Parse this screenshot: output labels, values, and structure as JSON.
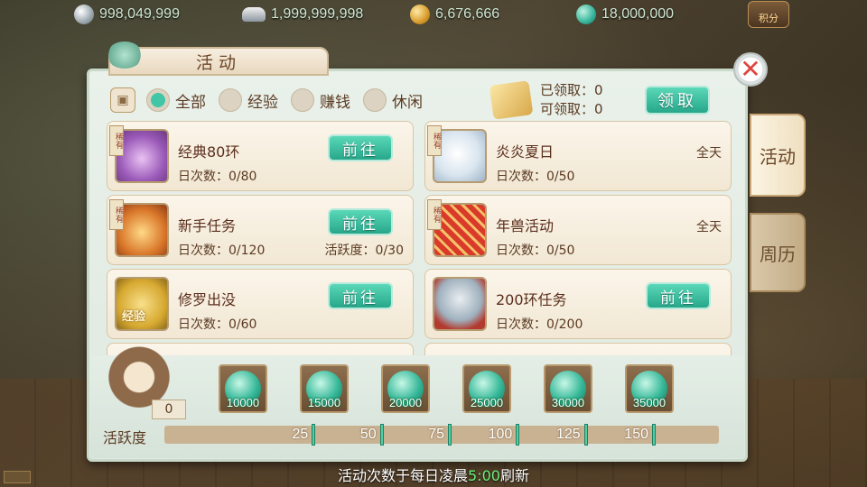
{
  "currencies": [
    {
      "icon": "silver-coin-icon",
      "value": "998,049,999"
    },
    {
      "icon": "silver-ingot-icon",
      "value": "1,999,999,998"
    },
    {
      "icon": "gold-coin-icon",
      "value": "6,676,666"
    },
    {
      "icon": "jade-icon",
      "value": "18,000,000"
    }
  ],
  "points_badge": "积分",
  "panel": {
    "title": "活动",
    "close_label": "✕"
  },
  "side_tabs": [
    {
      "label": "活动",
      "active": true
    },
    {
      "label": "周历",
      "active": false
    }
  ],
  "filter": {
    "options": [
      {
        "label": "全部",
        "selected": true
      },
      {
        "label": "经验",
        "selected": false
      },
      {
        "label": "赚钱",
        "selected": false
      },
      {
        "label": "休闲",
        "selected": false
      }
    ]
  },
  "claim": {
    "claimed_text": "已领取：0",
    "available_text": "可领取：0",
    "button_label": "领取"
  },
  "activities": [
    {
      "name": "经典80环",
      "count": "日次数：0/80",
      "tag": "稀有",
      "button": "前往",
      "time": "",
      "extra": ""
    },
    {
      "name": "炎炎夏日",
      "count": "日次数：0/50",
      "tag": "稀有",
      "button": "",
      "time": "全天",
      "extra": ""
    },
    {
      "name": "新手任务",
      "count": "日次数：0/120",
      "tag": "稀有",
      "button": "前往",
      "time": "",
      "extra": "活跃度：0/30"
    },
    {
      "name": "年兽活动",
      "count": "日次数：0/50",
      "tag": "稀有",
      "button": "",
      "time": "全天",
      "extra": ""
    },
    {
      "name": "修罗出没",
      "count": "日次数：0/60",
      "tag": "",
      "button": "前往",
      "time": "",
      "extra": "",
      "thumb_text": "经验"
    },
    {
      "name": "200环任务",
      "count": "日次数：0/200",
      "tag": "",
      "button": "前往",
      "time": "",
      "extra": ""
    }
  ],
  "score": "0",
  "rewards": [
    "10000",
    "15000",
    "20000",
    "25000",
    "30000",
    "35000"
  ],
  "activity_bar": {
    "label": "活跃度",
    "current": 0,
    "max": 150,
    "milestones": [
      "25",
      "50",
      "75",
      "100",
      "125",
      "150"
    ]
  },
  "footer": {
    "prefix": "活动次数于每日凌晨",
    "highlight": "5:00",
    "suffix": "刷新"
  }
}
